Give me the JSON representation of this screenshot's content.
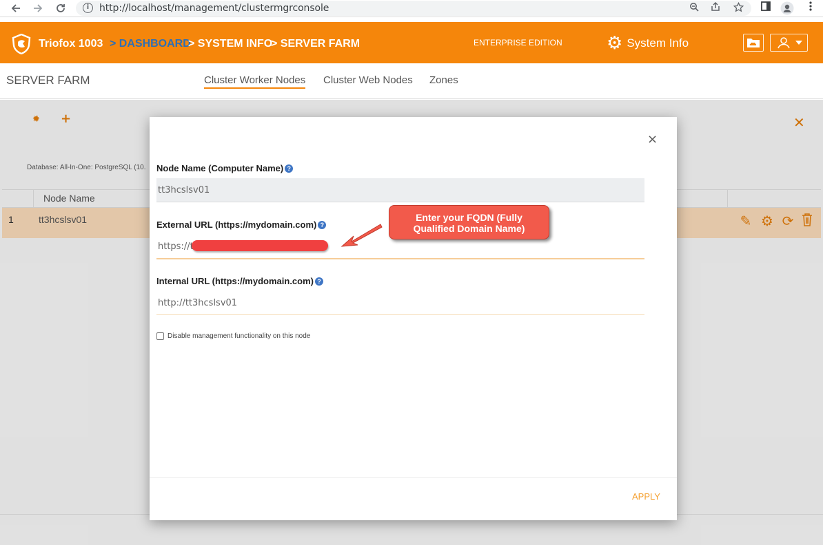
{
  "browser": {
    "url": "http://localhost/management/clustermgrconsole",
    "info_icon": "i"
  },
  "header": {
    "brand": "Triofox 1003",
    "breadcrumb": [
      {
        "label": "> DASHBOARD"
      },
      {
        "label": "> SYSTEM INFO"
      },
      {
        "label": "> SERVER FARM"
      }
    ],
    "edition": "ENTERPRISE EDITION",
    "system_info_label": "System Info",
    "brand_color": "#f5860b",
    "link_color": "#2f6fb3"
  },
  "subheader": {
    "title": "SERVER FARM",
    "tabs": [
      {
        "label": "Cluster Worker Nodes",
        "active": true
      },
      {
        "label": "Cluster Web Nodes",
        "active": false
      },
      {
        "label": "Zones",
        "active": false
      }
    ]
  },
  "background": {
    "database_text": "Database: All-In-One: PostgreSQL (10.",
    "table": {
      "columns": [
        "Node Name"
      ],
      "rows": [
        {
          "num": "1",
          "name": "tt3hcslsv01"
        }
      ]
    }
  },
  "modal": {
    "close_label": "×",
    "node_name_label": "Node Name (Computer Name)",
    "node_name_value": "tt3hcslsv01",
    "external_url_label": "External URL (https://mydomain.com)",
    "external_url_value": "https://t",
    "internal_url_label": "Internal URL (https://mydomain.com)",
    "internal_url_value": "http://tt3hcslsv01",
    "checkbox_label": "Disable management functionality on this node",
    "apply_label": "APPLY",
    "help_icon": "?"
  },
  "callout": {
    "line1": "Enter your FQDN (Fully",
    "line2": "Qualified Domain Name)",
    "color": "#f25a4b"
  }
}
